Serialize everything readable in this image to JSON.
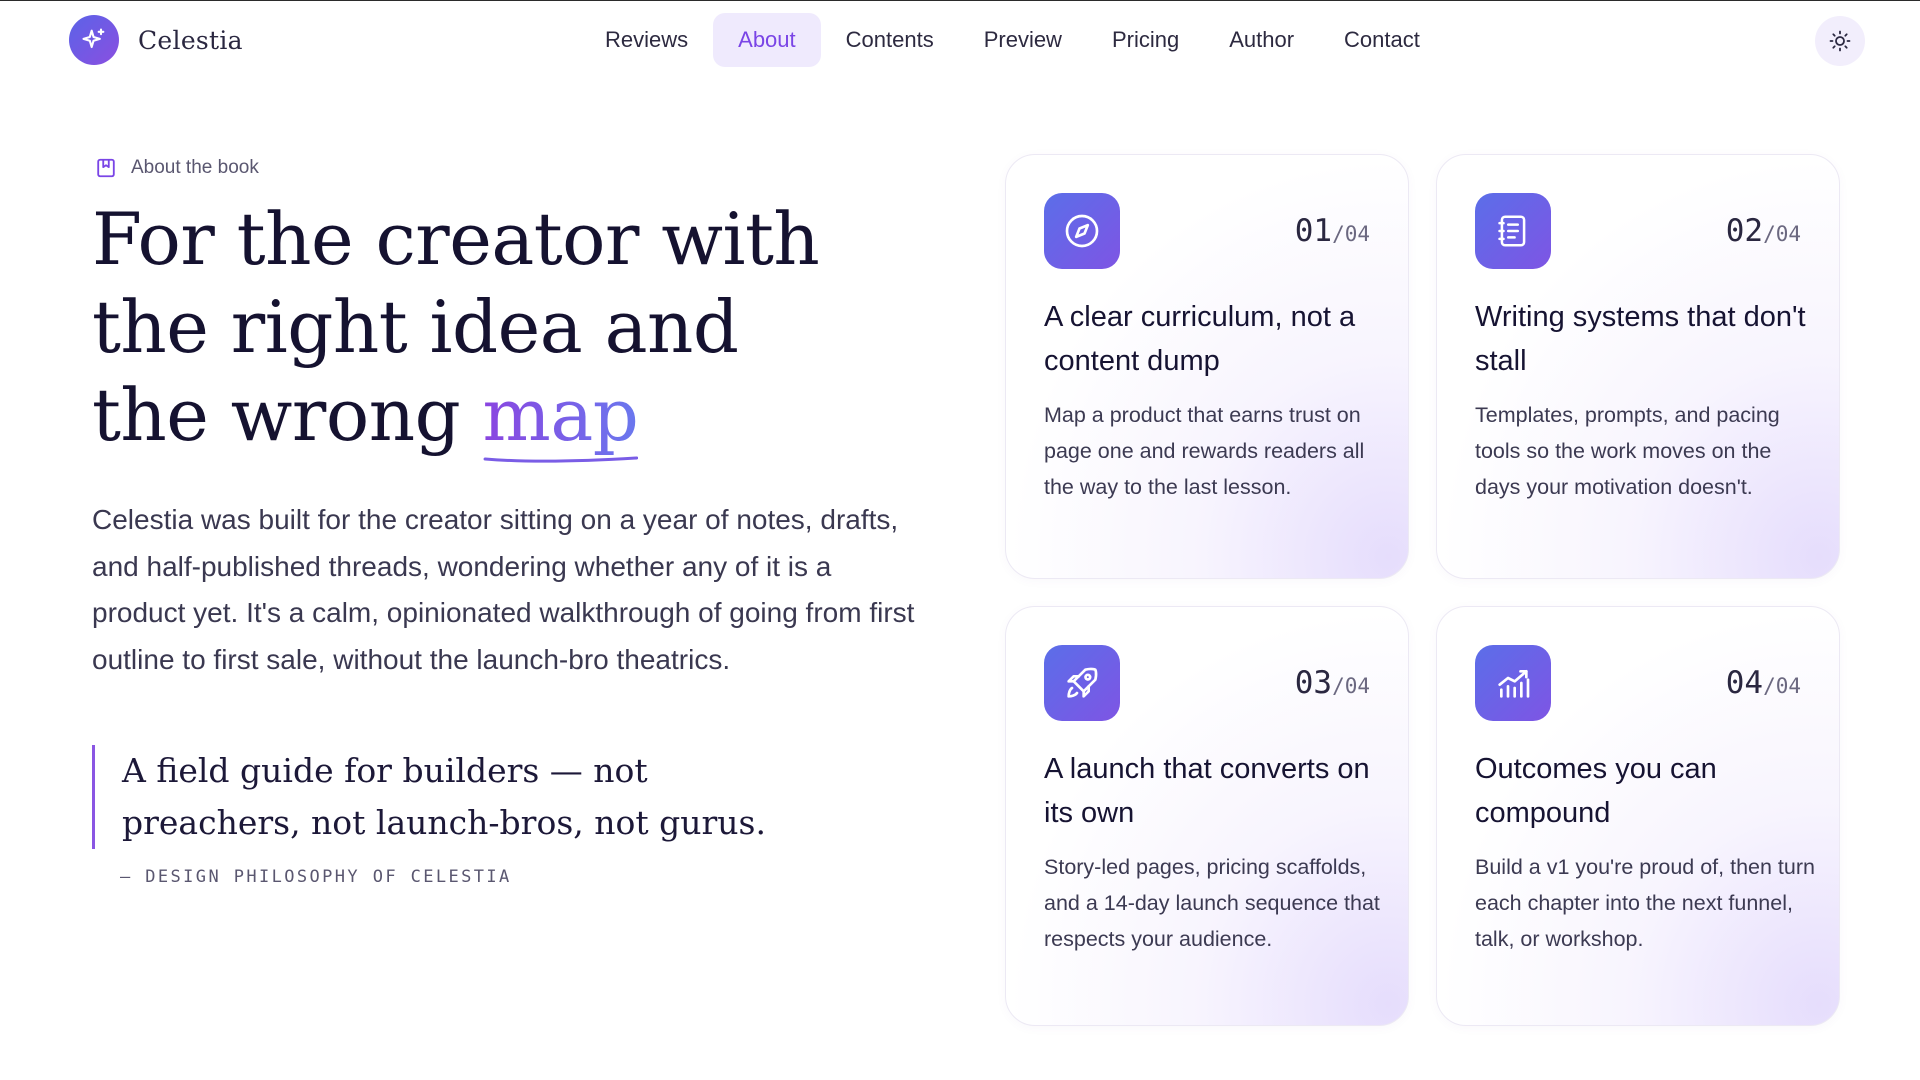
{
  "brand": {
    "name": "Celestia",
    "logo_icon": "sparkle-icon"
  },
  "nav": {
    "items": [
      {
        "label": "Reviews",
        "active": false
      },
      {
        "label": "About",
        "active": true
      },
      {
        "label": "Contents",
        "active": false
      },
      {
        "label": "Preview",
        "active": false
      },
      {
        "label": "Pricing",
        "active": false
      },
      {
        "label": "Author",
        "active": false
      },
      {
        "label": "Contact",
        "active": false
      }
    ],
    "theme_toggle_icon": "sun-icon"
  },
  "hero": {
    "eyebrow": "About the book",
    "eyebrow_icon": "bookmark-book-icon",
    "headline_line1": "For the creator with",
    "headline_line2": "the right idea and",
    "headline_line3_prefix": "the wrong",
    "headline_accent": "map",
    "lead": "Celestia was built for the creator sitting on a year of notes, drafts, and half-published threads, wondering whether any of it is a product yet. It's a calm, opinionated walkthrough of going from first outline to first sale, without the launch-bro theatrics.",
    "quote_line1": "A field guide for builders — not",
    "quote_line2": "preachers, not launch-bros, not gurus.",
    "quote_cite": "— DESIGN PHILOSOPHY OF CELESTIA"
  },
  "cards": [
    {
      "icon": "compass-icon",
      "num": "01",
      "total": "/04",
      "title": "A clear curriculum, not a content dump",
      "body": "Map a product that earns trust on page one and rewards readers all the way to the last lesson."
    },
    {
      "icon": "notebook-icon",
      "num": "02",
      "total": "/04",
      "title": "Writing systems that don't stall",
      "body": "Templates, prompts, and pacing tools so the work moves on the days your motivation doesn't."
    },
    {
      "icon": "rocket-icon",
      "num": "03",
      "total": "/04",
      "title": "A launch that converts on its own",
      "body": "Story-led pages, pricing scaffolds, and a 14-day launch sequence that respects your audience."
    },
    {
      "icon": "growth-chart-icon",
      "num": "04",
      "total": "/04",
      "title": "Outcomes you can compound",
      "body": "Build a v1 you're proud of, then turn each chapter into the next funnel, talk, or workshop."
    }
  ],
  "colors": {
    "accent": "#7a45e6",
    "accent_soft": "#efeafd",
    "icon_gradient_start": "#5b6ee9",
    "icon_gradient_end": "#7e55e4",
    "text_dark": "#151230"
  }
}
